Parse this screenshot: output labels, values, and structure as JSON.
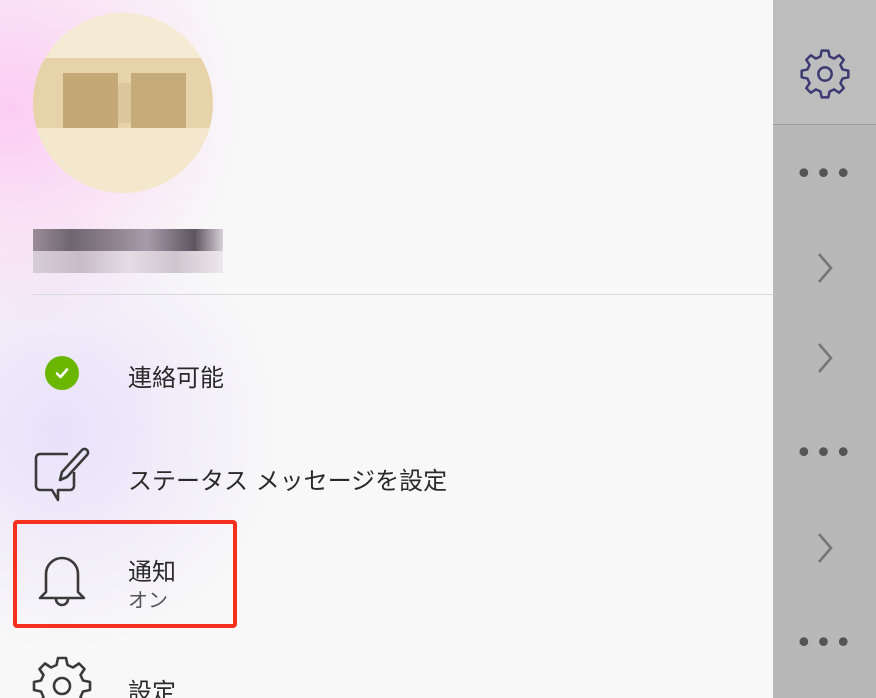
{
  "profile": {
    "avatar_alt": "",
    "display_name": ""
  },
  "menu": {
    "availability": {
      "label": "連絡可能",
      "status_color": "#6bb700"
    },
    "status_message": {
      "label": "ステータス メッセージを設定"
    },
    "notifications": {
      "label": "通知",
      "sub": "オン"
    },
    "settings": {
      "label": "設定"
    }
  },
  "right_panel": {
    "items": [
      {
        "icon": "gear-icon"
      },
      {
        "icon": "more-dots-icon"
      },
      {
        "icon": "chevron-right-icon"
      },
      {
        "icon": "chevron-right-icon"
      },
      {
        "icon": "more-dots-icon"
      },
      {
        "icon": "chevron-right-icon"
      },
      {
        "icon": "more-dots-icon"
      }
    ],
    "dots_text": "•••"
  },
  "colors": {
    "highlight": "#f5301e",
    "icon_stroke": "#3a3a3a",
    "gear_panel_stroke": "#3d3a73"
  }
}
